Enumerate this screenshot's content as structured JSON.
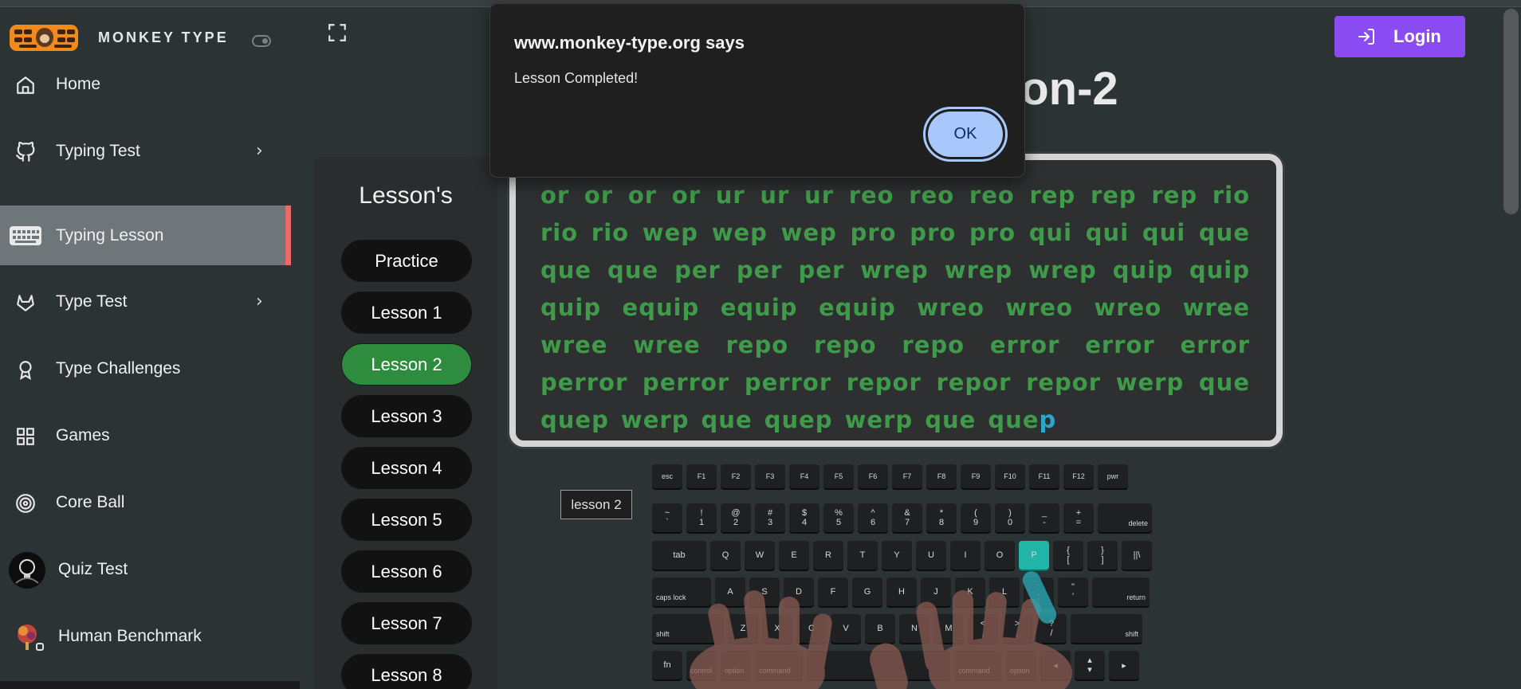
{
  "brand": {
    "name": "MONKEY TYPE"
  },
  "sidebar": {
    "items": [
      {
        "label": "Home",
        "icon": "home-icon"
      },
      {
        "label": "Typing Test",
        "icon": "github-icon",
        "has_submenu": true
      },
      {
        "label": "Typing Lesson",
        "icon": "keyboard-icon",
        "active": true
      },
      {
        "label": "Type Test",
        "icon": "gitlab-icon",
        "has_submenu": true
      },
      {
        "label": "Type Challenges",
        "icon": "award-icon"
      },
      {
        "label": "Games",
        "icon": "grid-icon"
      },
      {
        "label": "Core Ball",
        "icon": "target-icon"
      },
      {
        "label": "Quiz Test",
        "icon": "lightbulb-avatar-icon"
      },
      {
        "label": "Human Benchmark",
        "icon": "brain-avatar-icon"
      }
    ]
  },
  "header": {
    "login_label": "Login",
    "title_visible": "son-2"
  },
  "lessons": {
    "title": "Lesson's",
    "items": [
      "Practice",
      "Lesson 1",
      "Lesson 2",
      "Lesson 3",
      "Lesson 4",
      "Lesson 5",
      "Lesson 6",
      "Lesson 7",
      "Lesson 8"
    ],
    "active": "Lesson 2"
  },
  "typing": {
    "typed_text": "or or or or ur ur ur reo reo reo rep rep rep rio rio rio wep wep wep pro pro pro qui qui qui que que que per per per wrep wrep wrep quip quip quip equip equip equip wreo wreo wreo wree wree wree repo repo repo error error error perror perror perror repor repor repor werp que quep werp que quep werp que que",
    "current_char": "p",
    "lesson_tag": "lesson 2"
  },
  "keyboard": {
    "highlight_key": "P",
    "rows": [
      [
        "esc",
        "F1",
        "F2",
        "F3",
        "F4",
        "F5",
        "F6",
        "F7",
        "F8",
        "F9",
        "F10",
        "F11",
        "F12",
        "pwr"
      ],
      [
        "~|`",
        "!|1",
        "@|2",
        "#|3",
        "$|4",
        "%|5",
        "^|6",
        "&|7",
        "*|8",
        "(|9",
        ")|0",
        "_|-",
        "+|=",
        "delete"
      ],
      [
        "tab",
        "Q",
        "W",
        "E",
        "R",
        "T",
        "Y",
        "U",
        "I",
        "O",
        "P",
        "{|[",
        "}|]",
        "||\\"
      ],
      [
        "caps lock",
        "A",
        "S",
        "D",
        "F",
        "G",
        "H",
        "J",
        "K",
        "L",
        ":|;",
        "\"|'",
        "return"
      ],
      [
        "shift",
        "Z",
        "X",
        "C",
        "V",
        "B",
        "N",
        "M",
        "<|,",
        ">|.",
        "?|/",
        "shift"
      ],
      [
        "fn",
        "control",
        "option",
        "command",
        "",
        "command",
        "option",
        "◂",
        "▴|▾",
        "▸"
      ]
    ]
  },
  "dialog": {
    "title": "www.monkey-type.org says",
    "message": "Lesson Completed!",
    "ok_label": "OK"
  },
  "colors": {
    "background": "#2b3335",
    "active_lesson": "#2e8c3e",
    "typed_text": "#3f9a4a",
    "cursor_char": "#2ba6c9",
    "login": "#8a4cf2",
    "dialog_button": "#a8c7fa",
    "active_nav_marker": "#ea6a6a"
  }
}
